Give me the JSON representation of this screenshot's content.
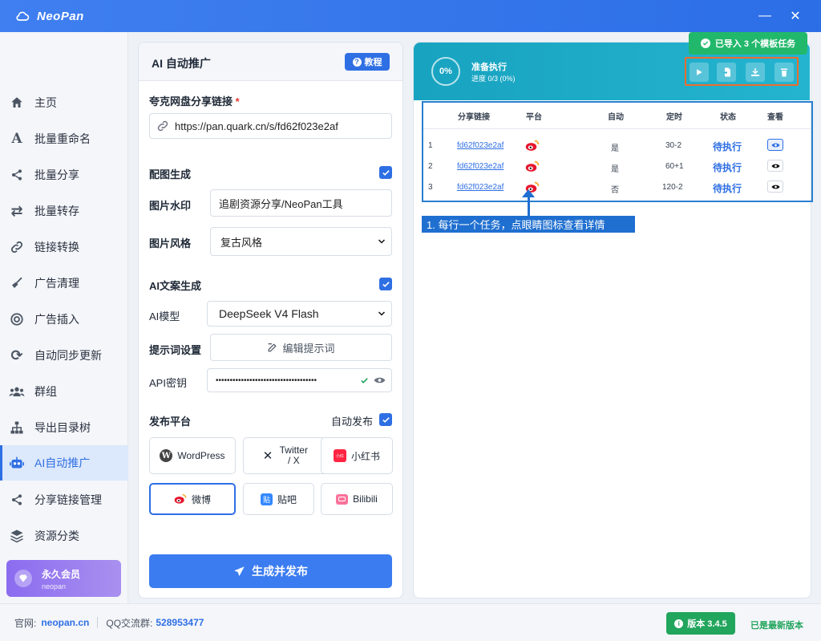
{
  "app": {
    "title": "NeoPan",
    "minimize": "—",
    "close": "✕"
  },
  "sidebar": {
    "items": [
      {
        "label": "主页",
        "icon": "home-icon"
      },
      {
        "label": "批量重命名",
        "icon": "letter-a-icon"
      },
      {
        "label": "批量分享",
        "icon": "share-icon"
      },
      {
        "label": "批量转存",
        "icon": "transfer-icon"
      },
      {
        "label": "链接转换",
        "icon": "link-icon"
      },
      {
        "label": "广告清理",
        "icon": "broom-icon"
      },
      {
        "label": "广告插入",
        "icon": "target-icon"
      },
      {
        "label": "自动同步更新",
        "icon": "sync-icon"
      },
      {
        "label": "群组",
        "icon": "users-icon"
      },
      {
        "label": "导出目录树",
        "icon": "sitemap-icon"
      },
      {
        "label": "AI自动推广",
        "icon": "robot-icon",
        "active": true
      },
      {
        "label": "分享链接管理",
        "icon": "share-icon"
      },
      {
        "label": "资源分类",
        "icon": "layers-icon"
      }
    ],
    "vip": {
      "title": "永久会员",
      "subtitle": "neopan"
    }
  },
  "left_panel": {
    "title": "AI 自动推广",
    "help_label": "教程",
    "share_link_label": "夸克网盘分享链接",
    "required_mark": "*",
    "share_link_value": "https://pan.quark.cn/s/fd62f023e2af",
    "image_gen_label": "配图生成",
    "watermark_label": "图片水印",
    "watermark_value": "追剧资源分享/NeoPan工具",
    "style_label": "图片风格",
    "style_value": "复古风格",
    "ai_copy_label": "AI文案生成",
    "model_label": "AI模型",
    "model_value": "DeepSeek V4 Flash",
    "prompt_label": "提示词设置",
    "prompt_button": "编辑提示词",
    "api_key_label": "API密钥",
    "api_key_value": "••••••••••••••••••••••••••••••••••••",
    "publish_label": "发布平台",
    "auto_publish_label": "自动发布",
    "platforms": [
      {
        "label": "WordPress"
      },
      {
        "label": "Twitter / X"
      },
      {
        "label": "小红书"
      },
      {
        "label": "微博",
        "selected": true
      },
      {
        "label": "贴吧"
      },
      {
        "label": "Bilibili"
      }
    ],
    "generate_button": "生成并发布"
  },
  "right_panel": {
    "progress_percent": "0%",
    "status_title": "准备执行",
    "status_progress": "进度 0/3 (0%)",
    "toast": "已导入 3 个模板任务",
    "columns": [
      "分享链接",
      "平台",
      "自动",
      "定时",
      "状态",
      "查看"
    ],
    "rows": [
      {
        "idx": "1",
        "link": "fd62f023e2af",
        "auto": "是",
        "timer": "30-2",
        "status": "待执行"
      },
      {
        "idx": "2",
        "link": "fd62f023e2af",
        "auto": "是",
        "timer": "60+1",
        "status": "待执行"
      },
      {
        "idx": "3",
        "link": "fd62f023e2af",
        "auto": "否",
        "timer": "120-2",
        "status": "待执行"
      }
    ],
    "annotation": "1. 每行一个任务，点眼睛图标查看详情"
  },
  "footer": {
    "site_label": "官网:",
    "site_value": "neopan.cn",
    "qq_label": "QQ交流群:",
    "qq_value": "528953477",
    "version": "版本 3.4.5",
    "latest": "已是最新版本"
  },
  "colors": {
    "accent": "#2f6fe4",
    "header": "#18a3c0",
    "success": "#22b86b",
    "highlight": "#ef6c2b"
  }
}
